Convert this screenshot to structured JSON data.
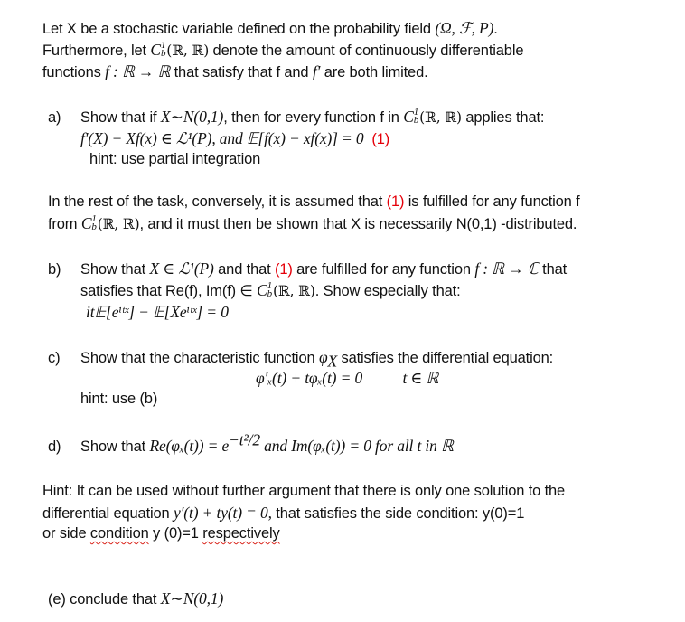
{
  "intro": {
    "line1_text": "Let X be a stochastic variable defined on the probability field ",
    "line1_math": "(Ω, ℱ, P)",
    "line1_end": ".",
    "line2_pre": "Furthermore, let ",
    "space_C": "C",
    "space_sup": "1",
    "space_sub": "b",
    "space_args": "(ℝ, ℝ)",
    "line2_post": " denote the amount of continuously differentiable",
    "line3_pre": "functions ",
    "line3_map": "f : ℝ → ℝ",
    "line3_mid": " that satisfy that f and ",
    "line3_fprime": "f′",
    "line3_post": " are both limited."
  },
  "part_a": {
    "label": "a)",
    "line1_pre": "Show that if ",
    "line1_math": "X∼N(0,1)",
    "line1_mid": ", then for every function f in ",
    "line1_post": " applies that:",
    "equation": "f′(X) − Xf(x) ∈ ℒ¹(P),  and 𝔼[f(x) − xf(x)] = 0",
    "equation_ref": "(1)",
    "hint": "hint: use partial integration"
  },
  "rest": {
    "line1_pre": "In the rest of the task, conversely, it is assumed that ",
    "ref": "(1)",
    "line1_post": " is fulfilled for any function f",
    "line2_pre": "from ",
    "line2_post": ", and it must then be shown that X is necessarily N(0,1) -distributed."
  },
  "part_b": {
    "label": "b)",
    "line1_pre": "Show that ",
    "line1_math": "X ∈ ℒ¹(P)",
    "line1_mid": " and that ",
    "ref": "(1)",
    "line1_mid2": " are fulfilled for any function ",
    "line1_map": "f : ℝ → ℂ",
    "line1_post": " that",
    "line2_pre": "satisfies that Re(f), Im(f) ∈ ",
    "line2_post": ".  Show especially that:",
    "equation": "it𝔼[eⁱᵗˣ] − 𝔼[Xeⁱᵗˣ] = 0"
  },
  "part_c": {
    "label": "c)",
    "line1_pre": "Show that the characteristic function ",
    "line1_math": "φ",
    "line1_math_sub": "X",
    "line1_post": " satisfies the differential equation:",
    "equation": "φ′ₓ(t) + tφₓ(t) = 0",
    "equation_domain": "t ∈ ℝ",
    "hint": "hint: use (b)"
  },
  "part_d": {
    "label": "d)",
    "pre": "Show that ",
    "math": "Re(φₓ(t)) = e",
    "exp": "−t²/2",
    "math2": " and Im(φₓ(t)) = 0 for all t in ℝ"
  },
  "final_hint": {
    "line1": "Hint: It can be used without further argument that there is only one solution to the",
    "line2_pre": "differential equation ",
    "line2_math": "y′(t) + ty(t) = 0,",
    "line2_post": "  that satisfies the side condition: y(0)=1",
    "line3_pre": "or side ",
    "line3_sq1": "condition",
    "line3_mid": " y (0)=1 ",
    "line3_sq2": "respectively"
  },
  "part_e": {
    "pre": "(e) conclude that ",
    "math": "X∼N(0,1)"
  },
  "colors": {
    "reference_red": "#e5000a",
    "spellcheck_red": "#d9231a"
  }
}
